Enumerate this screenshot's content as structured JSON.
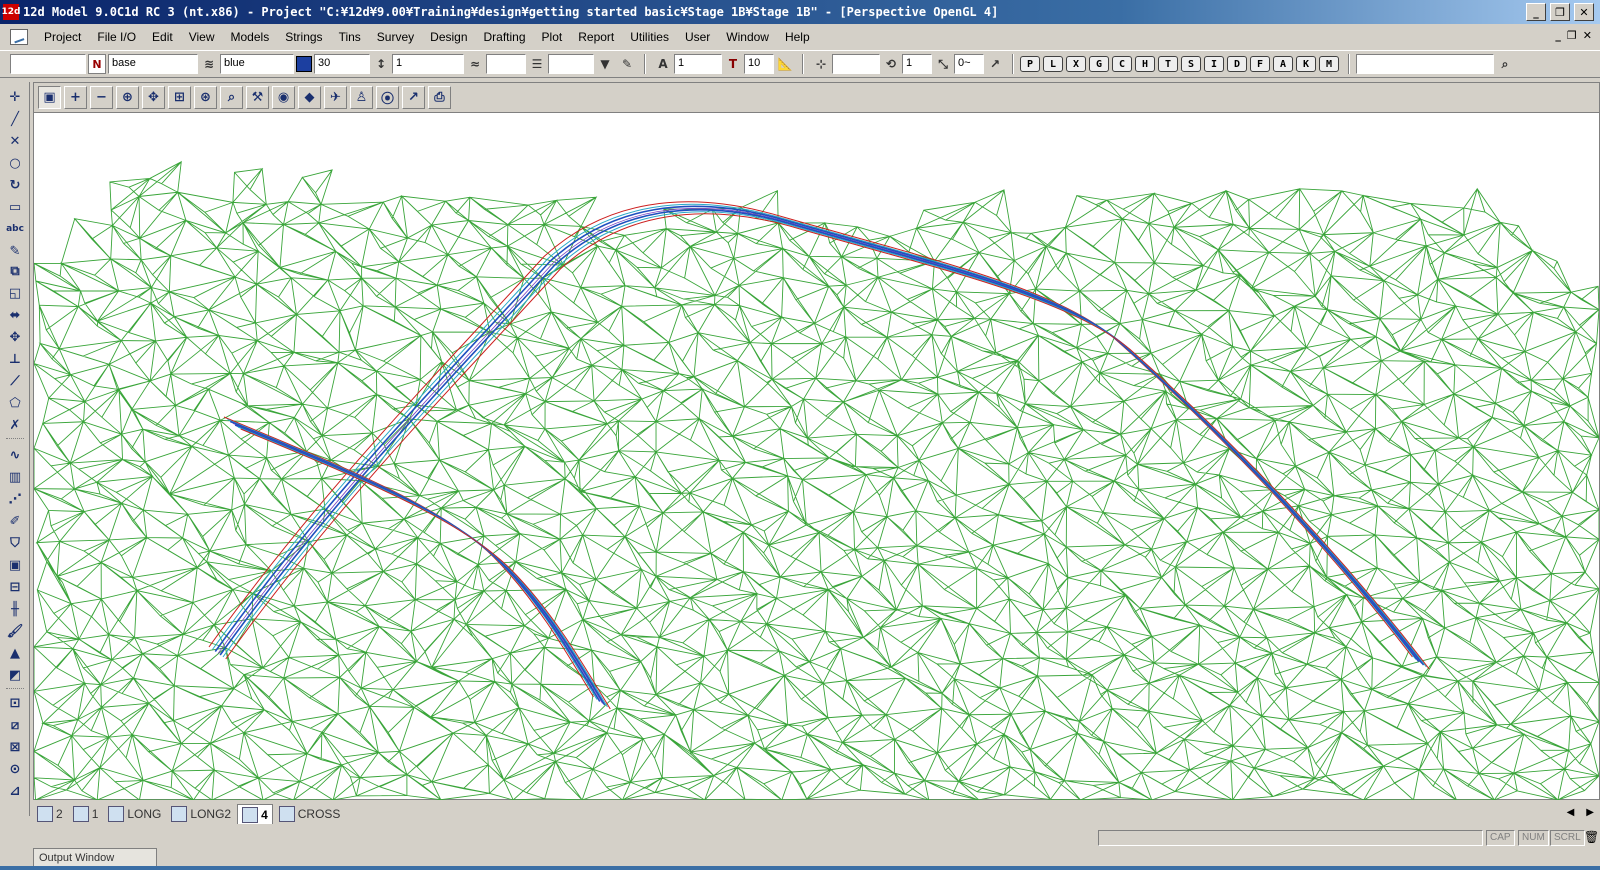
{
  "window": {
    "title": "12d Model 9.0C1d RC 3 (nt.x86) - Project \"C:¥12d¥9.00¥Training¥design¥getting started basic¥Stage 1B¥Stage 1B\" - [Perspective OpenGL 4]",
    "app_icon_text": "12d",
    "minimize": "_",
    "restore": "❐",
    "close": "✕"
  },
  "menu": {
    "items": [
      "Project",
      "File I/O",
      "Edit",
      "View",
      "Models",
      "Strings",
      "Tins",
      "Survey",
      "Design",
      "Drafting",
      "Plot",
      "Report",
      "Utilities",
      "User",
      "Window",
      "Help"
    ],
    "mdi_controls": [
      "_",
      "❐",
      "✕"
    ]
  },
  "toolbar": {
    "name_field": "",
    "name_icon": "N",
    "model_field": "base",
    "colour_field": "blue",
    "colour_swatch": "#1c3fa0",
    "weight_field": "30",
    "chainage_field": "1",
    "style_field": "",
    "linestyle_field": "",
    "text_field": "1",
    "text_icon": "T",
    "text_size_field": "10",
    "snap_field": "",
    "snap_count_field": "1",
    "snap_angle_field": "0~",
    "letter_buttons": [
      "P",
      "L",
      "X",
      "G",
      "C",
      "H",
      "T",
      "S",
      "I",
      "D",
      "F",
      "A",
      "K",
      "M"
    ],
    "search_field": ""
  },
  "view_toolbar": {
    "icons": [
      "view-select-icon",
      "zoom-in-plus-icon",
      "zoom-out-minus-icon",
      "zoom-window-icon",
      "pan-icon",
      "zoom-extents-icon",
      "zoom-fit-icon",
      "zoom-magnify-icon",
      "toggle-tools-icon",
      "eye-icon",
      "render-icon",
      "fly-through-icon",
      "walk-icon",
      "orbit-icon",
      "axis-icon",
      "print-icon"
    ],
    "glyphs": [
      "▣",
      "+",
      "−",
      "⊕",
      "✥",
      "⊞",
      "⊛",
      "⌕",
      "⚒",
      "◉",
      "◆",
      "✈",
      "♙",
      "⦿",
      "↗",
      "⎙"
    ]
  },
  "view": {
    "name": "Perspective OpenGL 4",
    "tin_colour": "#3aa53a",
    "road_colours": {
      "centreline": "#1f4fbf",
      "edge": "#cc1f1f",
      "verge": "#7a3fbf",
      "shoulder": "#2aa8c8"
    }
  },
  "tabs": [
    {
      "label": "2",
      "active": false
    },
    {
      "label": "1",
      "active": false
    },
    {
      "label": "LONG",
      "active": false
    },
    {
      "label": "LONG2",
      "active": false
    },
    {
      "label": "4",
      "active": true
    },
    {
      "label": "CROSS",
      "active": false
    }
  ],
  "tab_nav": {
    "prev": "◀",
    "next": "▶"
  },
  "status": {
    "indicators": [
      "CAP",
      "NUM",
      "SCRL"
    ]
  },
  "output_window": {
    "label": "Output Window"
  }
}
